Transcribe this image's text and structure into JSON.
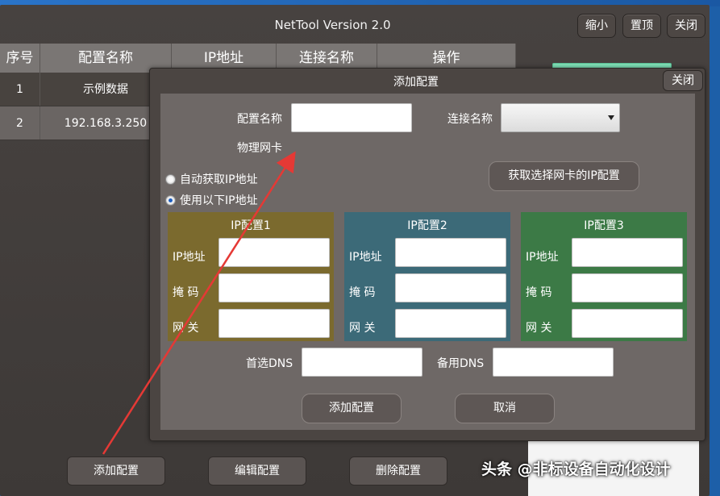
{
  "window": {
    "title": "NetTool Version 2.0",
    "buttons": [
      "缩小",
      "置顶",
      "关闭"
    ]
  },
  "table": {
    "headers": [
      "序号",
      "配置名称",
      "IP地址",
      "连接名称",
      "操作"
    ],
    "rows": [
      [
        "1",
        "示例数据",
        "",
        "",
        ""
      ],
      [
        "2",
        "192.168.3.250",
        "",
        "",
        ""
      ]
    ]
  },
  "bottom_buttons": [
    "添加配置",
    "编辑配置",
    "删除配置"
  ],
  "dialog": {
    "title": "添加配置",
    "close_label": "关闭",
    "config_name_label": "配置名称",
    "config_name_value": "",
    "connection_name_label": "连接名称",
    "connection_name_value": "",
    "nic_label": "物理网卡",
    "radio_auto_label": "自动获取IP地址",
    "radio_manual_label": "使用以下IP地址",
    "radio_selected": "manual",
    "get_nic_config_label": "获取选择网卡的IP配置",
    "ip_panels": [
      {
        "title": "IP配置1",
        "color": "#7b6a2e",
        "ip_label": "IP地址",
        "mask_label": "掩 码",
        "gateway_label": "网 关"
      },
      {
        "title": "IP配置2",
        "color": "#3c6a78",
        "ip_label": "IP地址",
        "mask_label": "掩 码",
        "gateway_label": "网 关"
      },
      {
        "title": "IP配置3",
        "color": "#3c7a46",
        "ip_label": "IP地址",
        "mask_label": "掩 码",
        "gateway_label": "网 关"
      }
    ],
    "dns_primary_label": "首选DNS",
    "dns_secondary_label": "备用DNS",
    "add_button_label": "添加配置",
    "cancel_button_label": "取消"
  },
  "watermark": "头条 @非标设备自动化设计",
  "colors": {
    "annotation_arrow": "#e53935",
    "desktop": "#1d5fa8"
  }
}
